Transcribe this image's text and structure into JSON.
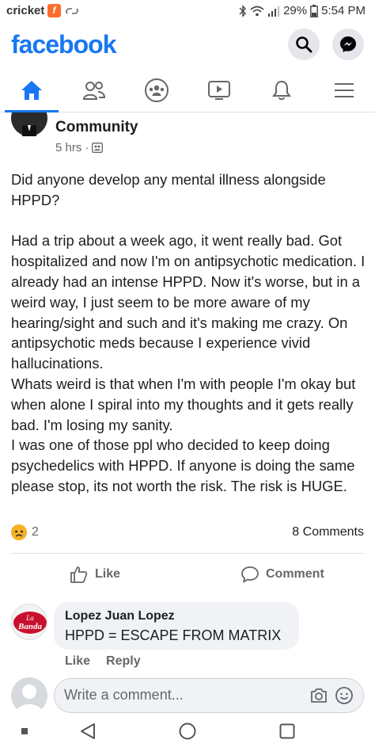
{
  "status_bar": {
    "carrier": "cricket",
    "battery": "29%",
    "time": "5:54 PM"
  },
  "header": {
    "logo": "facebook",
    "buttons": [
      {
        "icon": "search-icon"
      },
      {
        "icon": "messenger-icon"
      }
    ]
  },
  "nav": {
    "tabs": [
      {
        "icon": "home-icon",
        "active": true
      },
      {
        "icon": "friends-icon",
        "active": false
      },
      {
        "icon": "groups-icon",
        "active": false
      },
      {
        "icon": "watch-icon",
        "active": false
      },
      {
        "icon": "notifications-icon",
        "active": false
      },
      {
        "icon": "menu-icon",
        "active": false
      }
    ]
  },
  "post": {
    "group_name": "Community",
    "time": "5 hrs",
    "body": "Did anyone develop any mental illness alongside HPPD?\n\nHad a trip about a week ago, it went really bad. Got hospitalized and now I'm on antipsychotic medication. I already had an intense HPPD. Now it's worse, but in a weird way, I just seem to be more aware of my hearing/sight and such and it's making me crazy. On antipsychotic meds because I experience vivid hallucinations.\nWhats weird is that when I'm with people I'm okay but when alone I spiral into my thoughts and it gets really bad. I'm losing my sanity.\nI was one of those ppl who decided to keep doing psychedelics with HPPD. If anyone is doing the same please stop, its not worth the risk. The risk is HUGE.",
    "reaction_count": "2",
    "comments_count": "8 Comments",
    "like_label": "Like",
    "comment_label": "Comment"
  },
  "comment": {
    "author": "Lopez Juan Lopez",
    "text": "HPPD = ESCAPE FROM MATRIX",
    "like_label": "Like",
    "reply_label": "Reply",
    "avatar_text": "La Banda"
  },
  "write_comment": {
    "placeholder": "Write a comment..."
  },
  "colors": {
    "brand": "#1877f2",
    "secondary_text": "#65676b",
    "bubble": "#f0f2f5"
  }
}
